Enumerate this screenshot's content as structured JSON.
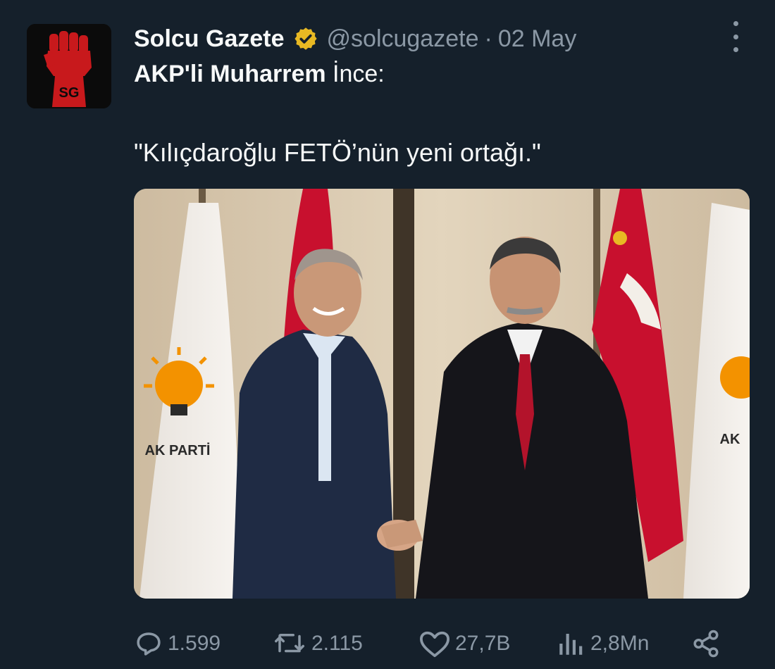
{
  "tweet": {
    "author": {
      "display_name": "Solcu Gazete",
      "handle": "@solcugazete",
      "verified": true,
      "avatar_text": "SG"
    },
    "separator": "·",
    "date": "02 May",
    "text": {
      "bold_part": "AKP'li Muharrem",
      "rest_part": " İnce:",
      "quote": "\"Kılıçdaroğlu FETÖ’nün yeni ortağı.\""
    },
    "media": {
      "banner_text_left": "AK PARTİ",
      "banner_text_right": "AK"
    },
    "stats": {
      "replies": "1.599",
      "retweets": "2.115",
      "likes": "27,7B",
      "views": "2,8Mn"
    }
  },
  "colors": {
    "background": "#15202b",
    "text_primary": "#f7f9f9",
    "text_secondary": "#8b98a5",
    "verified_gold": "#e8b923",
    "akp_orange": "#f39200",
    "turkish_red": "#c8102e"
  },
  "icons": {
    "more": "more-options-icon",
    "verified": "verified-badge-icon",
    "reply": "reply-icon",
    "retweet": "retweet-icon",
    "like": "like-icon",
    "views": "views-icon",
    "share": "share-icon"
  }
}
